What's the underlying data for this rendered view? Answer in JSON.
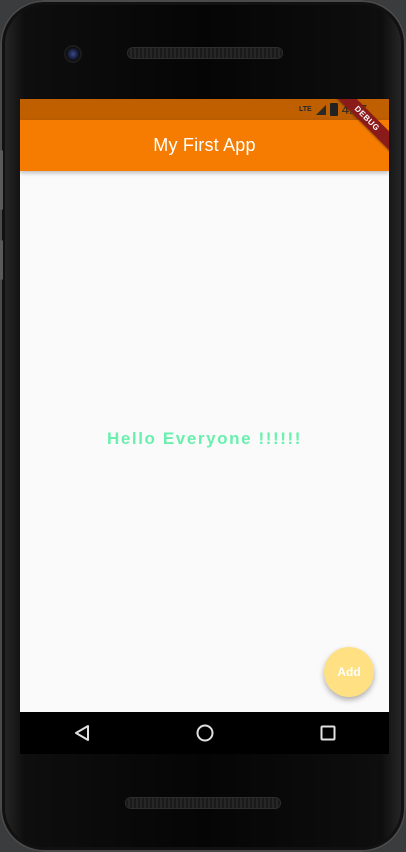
{
  "status_bar": {
    "network": "LTE",
    "time": "4:17"
  },
  "app_bar": {
    "title": "My First App"
  },
  "debug_banner": "DEBUG",
  "body": {
    "greeting": "Hello Everyone !!!!!!"
  },
  "fab": {
    "label": "Add"
  },
  "colors": {
    "status_bar": "#bf5f00",
    "app_bar": "#f57c00",
    "greeting": "#69f0ae",
    "fab": "#ffe082",
    "background": "#fafafa"
  },
  "icons": {
    "nav_back": "triangle-back-icon",
    "nav_home": "circle-home-icon",
    "nav_recents": "square-recents-icon"
  }
}
